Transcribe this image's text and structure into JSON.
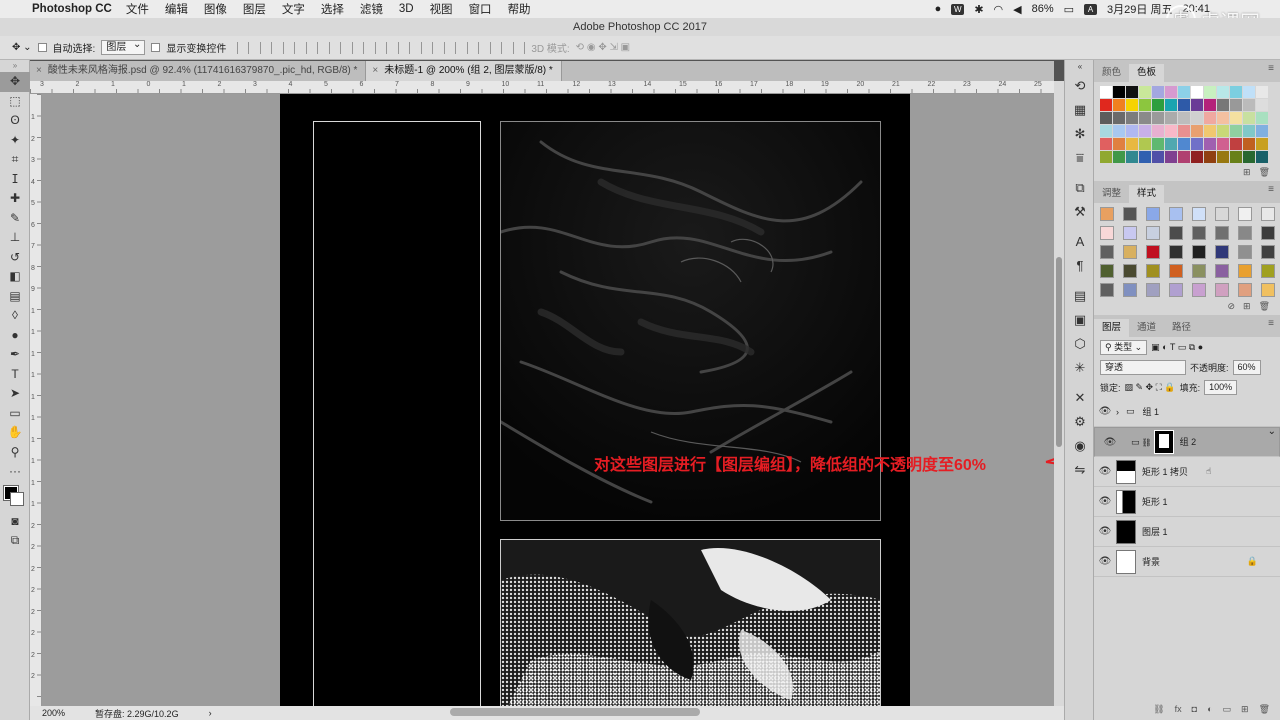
{
  "menubar": {
    "app_name": "Photoshop CC",
    "items": [
      "文件",
      "编辑",
      "图像",
      "图层",
      "文字",
      "选择",
      "滤镜",
      "3D",
      "视图",
      "窗口",
      "帮助"
    ],
    "battery": "86%",
    "date": "3月29日 周五",
    "time": "20:41",
    "input_method": "A",
    "watermark": "虎课网"
  },
  "window": {
    "title": "Adobe Photoshop CC 2017"
  },
  "options_bar": {
    "auto_select_label": "自动选择:",
    "auto_select_value": "图层",
    "show_transform_label": "显示变换控件",
    "mode_3d_label": "3D 模式:"
  },
  "tabs": [
    {
      "label": "酸性未来风格海报.psd @ 92.4% (11741616379870_.pic_hd, RGB/8) *"
    },
    {
      "label": "未标题-1 @ 200% (组 2, 图层蒙版/8) *"
    }
  ],
  "rulers": {
    "h_labels": [
      "3",
      "2",
      "1",
      "0",
      "1",
      "2",
      "3",
      "4",
      "5",
      "6",
      "7",
      "8",
      "9",
      "10",
      "11",
      "12",
      "13",
      "14",
      "15",
      "16",
      "17",
      "18",
      "19",
      "20",
      "21",
      "22",
      "23",
      "24",
      "25"
    ],
    "v_labels": [
      "1",
      "2",
      "3",
      "4",
      "5",
      "6",
      "7",
      "8",
      "9",
      "1",
      "1",
      "1",
      "1",
      "1",
      "1",
      "1",
      "1",
      "1",
      "1",
      "2",
      "2",
      "2",
      "2",
      "2",
      "2",
      "2",
      "2"
    ]
  },
  "status": {
    "zoom": "200%",
    "scratch": "暂存盘: 2.29G/10.2G",
    "arrow": "›"
  },
  "annotation": {
    "text": "对这些图层进行【图层编组】，降低组的不透明度至60%",
    "color": "#e51d23"
  },
  "swatches_panel": {
    "tabs": [
      "颜色",
      "色板"
    ],
    "colors": [
      "#ffffff",
      "#000000",
      "#111111",
      "#c9e89a",
      "#a3a7e0",
      "#d69ad0",
      "#8cd0e8",
      "#ffffff",
      "#c8f0c0",
      "#b8e8e8",
      "#7ccfe0",
      "#c0e0f8",
      "#e8e8e8",
      "#e0281e",
      "#f08020",
      "#f6d300",
      "#8cc63e",
      "#2e9e3e",
      "#1aa4b0",
      "#2e5aa8",
      "#6a3c96",
      "#b4227a",
      "#777777",
      "#999999",
      "#bbbbbb",
      "#dddddd",
      "#5c5c5c",
      "#6a6a6a",
      "#7c7c7c",
      "#8a8a8a",
      "#9a9a9a",
      "#ababab",
      "#bdbdbd",
      "#d0d0d0",
      "#f0a8a0",
      "#f4c0a0",
      "#f4e0a0",
      "#c8e0a0",
      "#a8e0c0",
      "#a8d8e0",
      "#a8c8f0",
      "#b0b8f0",
      "#c8b0e8",
      "#e8b0d0",
      "#f8b8c8",
      "#e89090",
      "#e8a070",
      "#f0c870",
      "#c8d878",
      "#90d0a0",
      "#80c8c8",
      "#80b0e0",
      "#e06060",
      "#e08040",
      "#e8b840",
      "#b0c850",
      "#60b870",
      "#50a8b0",
      "#5088d0",
      "#7070c8",
      "#a060b0",
      "#d06090",
      "#c04040",
      "#c06020",
      "#c8a020",
      "#90a830",
      "#409848",
      "#308890",
      "#3060b0",
      "#5050a8",
      "#804090",
      "#b04070",
      "#902020",
      "#904010",
      "#987810",
      "#688018",
      "#286830",
      "#186068"
    ]
  },
  "styles_panel": {
    "tabs": [
      "调整",
      "样式"
    ],
    "items": [
      "#e8a060",
      "#555555",
      "#8aa8e8",
      "#a8c0f0",
      "#d0e0f8",
      "#d8d8d8",
      "#f0f0f0",
      "#e8e8e8",
      "#f8d8d8",
      "#c8c8f0",
      "#c8d0e0",
      "#4c4c4c",
      "#606060",
      "#707070",
      "#888888",
      "#3c3c3c",
      "#606060",
      "#d8b060",
      "#c01020",
      "#303030",
      "#202020",
      "#303878",
      "#909090",
      "#404040",
      "#506030",
      "#4a4a30",
      "#a09020",
      "#d06020",
      "#8a9060",
      "#8a60a0",
      "#e8a030",
      "#a0a020",
      "#606060",
      "#8090c0",
      "#a0a0c0",
      "#b0a0d0",
      "#c8a0d0",
      "#d0a0c0",
      "#e0a080",
      "#f0c060"
    ]
  },
  "layers_panel": {
    "tabs": [
      "图层",
      "通道",
      "路径"
    ],
    "filter_label": "类型",
    "blend_mode": "穿透",
    "opacity_label": "不透明度:",
    "opacity_value": "60%",
    "lock_label": "锁定:",
    "fill_label": "填充:",
    "fill_value": "100%",
    "layers": [
      {
        "name": "组 1",
        "type": "group",
        "selected": false
      },
      {
        "name": "组 2",
        "type": "group-mask",
        "selected": true
      },
      {
        "name": "矩形 1 拷贝",
        "type": "shape",
        "selected": false
      },
      {
        "name": "矩形 1",
        "type": "shape",
        "selected": false
      },
      {
        "name": "图层 1",
        "type": "black",
        "selected": false
      },
      {
        "name": "背景",
        "type": "white",
        "selected": false,
        "locked": true
      }
    ]
  },
  "icons": [
    "apple-logo",
    "move-tool",
    "marquee-tool",
    "lasso-tool",
    "magic-wand-tool",
    "crop-tool",
    "eyedropper-tool",
    "healing-tool",
    "brush-tool",
    "stamp-tool",
    "history-brush-tool",
    "eraser-tool",
    "gradient-tool",
    "blur-tool",
    "dodge-tool",
    "pen-tool",
    "type-tool",
    "path-select-tool",
    "rectangle-tool",
    "hand-tool",
    "zoom-tool",
    "more-tools",
    "quick-mask",
    "screen-mode",
    "eye-icon",
    "lock-icon",
    "folder-icon"
  ]
}
